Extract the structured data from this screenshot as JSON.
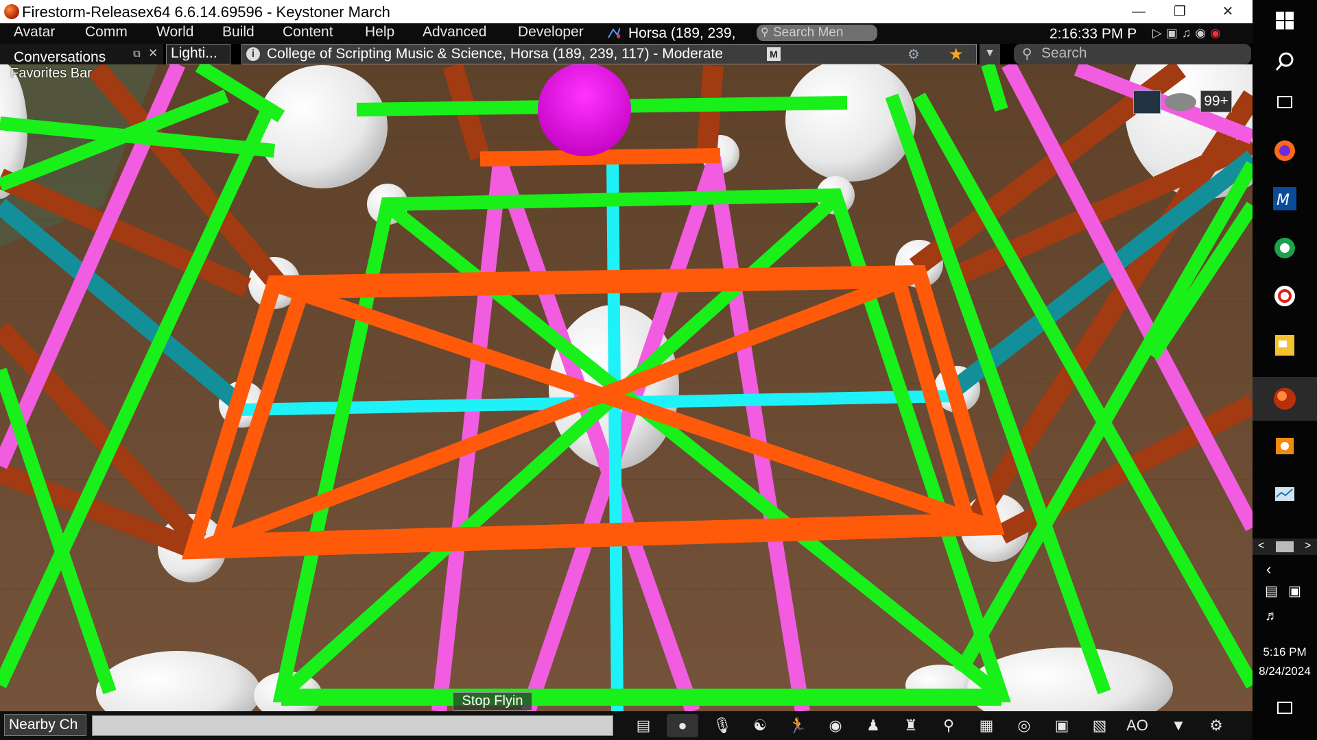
{
  "window": {
    "title": "Firestorm-Releasex64 6.6.14.69596 - Keystoner March",
    "minimize": "—",
    "restore": "❐",
    "close": "✕"
  },
  "menubar": {
    "items": [
      "Avatar",
      "Comm",
      "World",
      "Build",
      "Content",
      "Help",
      "Advanced",
      "Developer"
    ],
    "location": "Horsa (189, 239,",
    "search_placeholder": "Search Men",
    "clock": "2:16:33 PM P"
  },
  "navbar": {
    "conversations": "Conversations",
    "lighting_tab": "Lighti...",
    "address": "College of Scripting Music & Science, Horsa (189, 239, 117) - Moderate",
    "maturity_badge": "M",
    "search_placeholder": "Search"
  },
  "favorites_bar": "Favorites Bar",
  "hud": {
    "notifications": "99+"
  },
  "viewport": {
    "stop_flying": "Stop Flyin",
    "colors": {
      "floor": "#6b4a30",
      "green": "#19ef19",
      "orange": "#ff5a0a",
      "rust": "#a23a12",
      "pink": "#f25ce0",
      "cyan": "#1ef2f8",
      "teal": "#138f9a",
      "magenta": "#ee14e6",
      "sphere": "#f2f2f2"
    }
  },
  "bottombar": {
    "nearby_chat": "Nearby Ch",
    "ao_label": "AO"
  },
  "taskbar": {
    "time": "5:16 PM",
    "date": "8/24/2024"
  }
}
